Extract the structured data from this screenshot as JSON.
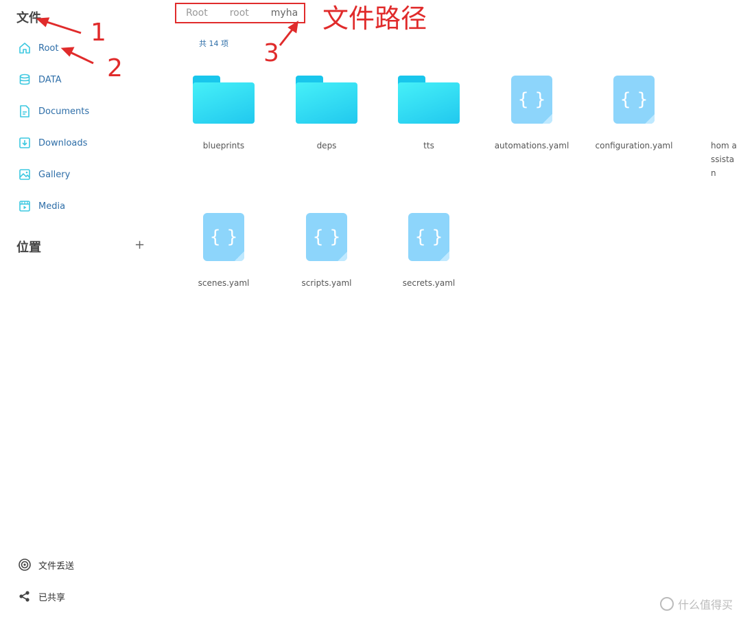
{
  "sidebar": {
    "files_title": "文件",
    "items": [
      {
        "label": "Root",
        "icon": "home-icon"
      },
      {
        "label": "DATA",
        "icon": "database-icon"
      },
      {
        "label": "Documents",
        "icon": "document-icon"
      },
      {
        "label": "Downloads",
        "icon": "download-icon"
      },
      {
        "label": "Gallery",
        "icon": "image-icon"
      },
      {
        "label": "Media",
        "icon": "media-icon"
      }
    ],
    "locations_title": "位置",
    "add_label": "+",
    "bottom": [
      {
        "label": "文件丢送",
        "icon": "airdrop-icon"
      },
      {
        "label": "已共享",
        "icon": "share-icon"
      }
    ]
  },
  "breadcrumb": [
    "Root",
    "root",
    "myha"
  ],
  "path_annotation": "文件路径",
  "item_count": "共 14 项",
  "files": [
    {
      "name": "blueprints",
      "type": "folder"
    },
    {
      "name": "deps",
      "type": "folder"
    },
    {
      "name": "tts",
      "type": "folder"
    },
    {
      "name": "automations.yaml",
      "type": "yaml"
    },
    {
      "name": "configuration.yaml",
      "type": "yaml"
    },
    {
      "name": "hom assistan",
      "type": "file"
    },
    {
      "name": "scenes.yaml",
      "type": "yaml"
    },
    {
      "name": "scripts.yaml",
      "type": "yaml"
    },
    {
      "name": "secrets.yaml",
      "type": "yaml"
    }
  ],
  "annotations": [
    "1",
    "2",
    "3"
  ],
  "watermark": "什么值得买",
  "colors": {
    "accent": "#2e6ea8",
    "icon": "#3cc8e0",
    "annotation": "#e02b2b",
    "folder": "#21c8ee",
    "yaml": "#8dd5fb"
  }
}
